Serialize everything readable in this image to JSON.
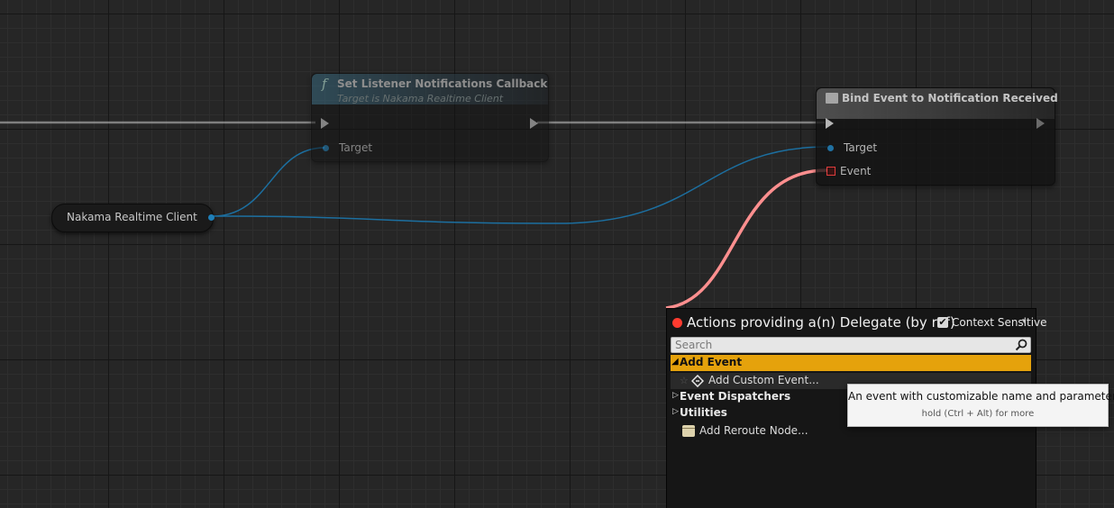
{
  "graph": {
    "var_node": {
      "label": "Nakama Realtime Client"
    },
    "node_set_listener": {
      "title": "Set Listener Notifications Callback",
      "subtitle": "Target is Nakama Realtime Client",
      "icon": "function-icon",
      "target_label": "Target"
    },
    "node_bind_event": {
      "title": "Bind Event to Notification Received",
      "icon": "event-dispatcher-icon",
      "target_label": "Target",
      "event_label": "Event"
    },
    "colors": {
      "exec_wire": "#c8c8c8",
      "object_wire": "#1c6fa0",
      "delegate_wire": "#ff8f8f",
      "selected_category": "#e5a20c"
    }
  },
  "action_menu": {
    "title": "Actions providing a(n) Delegate (by ref)",
    "context_sensitive_label": "Context Sensitive",
    "context_sensitive_checked": true,
    "search_placeholder": "Search",
    "categories": [
      {
        "label": "Add Event",
        "expanded": true,
        "selected": true
      },
      {
        "label": "Event Dispatchers",
        "expanded": false
      },
      {
        "label": "Utilities",
        "expanded": false
      }
    ],
    "add_event_items": [
      {
        "label": "Add Custom Event...",
        "icon": "custom-event-icon"
      }
    ],
    "root_items": [
      {
        "label": "Add Reroute Node...",
        "icon": "reroute-node-icon"
      }
    ]
  },
  "tooltip": {
    "text": "An event with customizable name and parameters.",
    "hint": "hold (Ctrl + Alt) for more"
  }
}
